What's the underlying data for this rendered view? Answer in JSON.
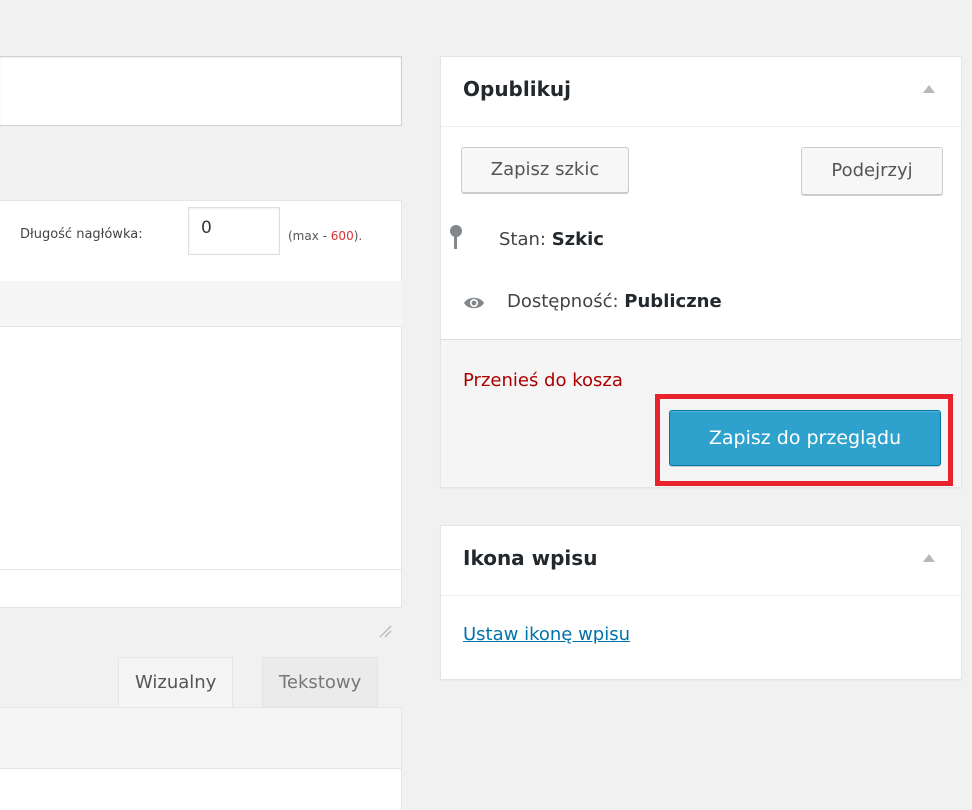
{
  "excerpt": {
    "length_label": "Długość nagłówka:",
    "length_value": "0",
    "max_prefix": "(max - ",
    "max_value": "600",
    "max_suffix": ")."
  },
  "editor": {
    "tab_visual": "Wizualny",
    "tab_text": "Tekstowy"
  },
  "publish": {
    "title": "Opublikuj",
    "save_draft": "Zapisz szkic",
    "preview": "Podejrzyj",
    "status_label": "Stan: ",
    "status_value": "Szkic",
    "visibility_label": "Dostępność: ",
    "visibility_value": "Publiczne",
    "trash": "Przenieś do kosza",
    "submit": "Zapisz do przeglądu"
  },
  "post_icon": {
    "title": "Ikona wpisu",
    "set_link": "Ustaw ikonę wpisu"
  },
  "colors": {
    "primary": "#2ea2cc",
    "trash": "#aa0000",
    "highlight": "#e8232d",
    "link": "#0073aa"
  }
}
